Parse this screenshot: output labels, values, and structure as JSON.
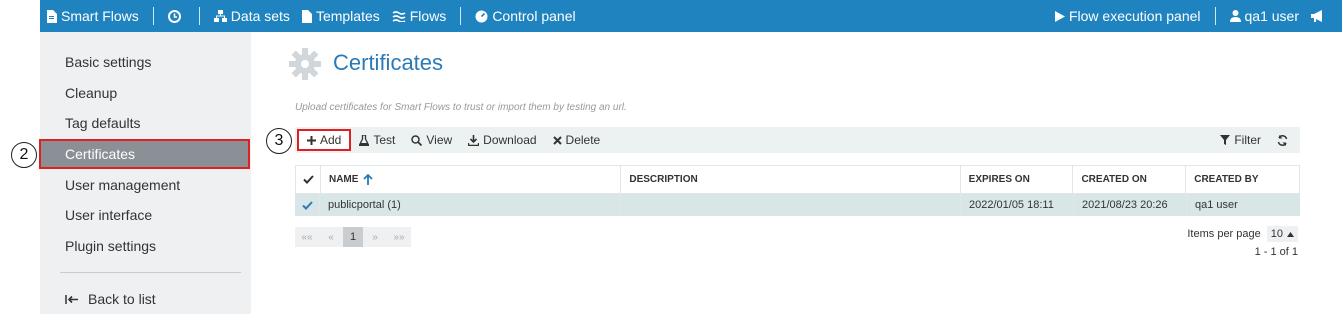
{
  "navbar": {
    "brand": "Smart Flows",
    "datasets": "Data sets",
    "templates": "Templates",
    "flows": "Flows",
    "control_panel": "Control panel",
    "flow_execution_panel": "Flow execution panel",
    "user": "qa1 user"
  },
  "sidebar": {
    "items": [
      {
        "label": "Basic settings"
      },
      {
        "label": "Cleanup"
      },
      {
        "label": "Tag defaults"
      },
      {
        "label": "Certificates"
      },
      {
        "label": "User management"
      },
      {
        "label": "User interface"
      },
      {
        "label": "Plugin settings"
      }
    ],
    "back": "Back to list",
    "active_index": 3
  },
  "annotations": {
    "sidebar_marker": "2",
    "toolbar_marker": "3"
  },
  "page": {
    "title": "Certificates",
    "description": "Upload certificates for Smart Flows to trust or import them by testing an url."
  },
  "toolbar": {
    "add": "Add",
    "test": "Test",
    "view": "View",
    "download": "Download",
    "delete": "Delete",
    "filter": "Filter"
  },
  "grid": {
    "columns": [
      "NAME",
      "DESCRIPTION",
      "EXPIRES ON",
      "CREATED ON",
      "CREATED BY"
    ],
    "rows": [
      {
        "name": "publicportal (1)",
        "description": "",
        "expires_on": "2022/01/05 18:11",
        "created_on": "2021/08/23 20:26",
        "created_by": "qa1 user",
        "selected": true
      }
    ]
  },
  "pager": {
    "first": "««",
    "prev": "«",
    "current": "1",
    "next": "»",
    "last": "»»",
    "items_per_page_label": "Items per page",
    "items_per_page": "10",
    "count": "1 - 1 of 1"
  },
  "colors": {
    "navbar": "#1f83c0",
    "title": "#2b7ab8",
    "highlight": "#e02020",
    "selected_row": "#d9e6e8"
  }
}
